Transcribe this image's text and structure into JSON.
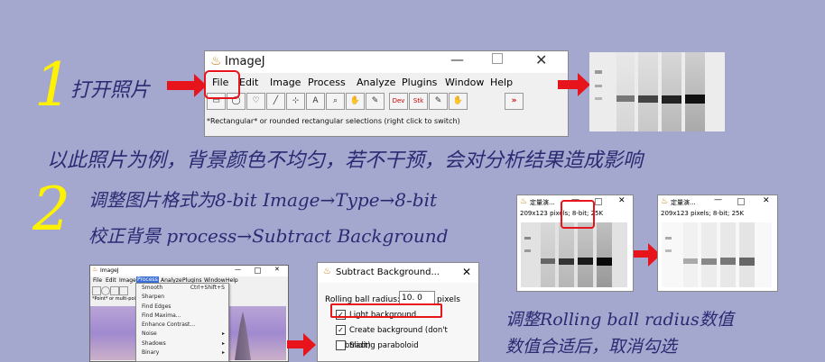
{
  "steps": {
    "step1_number": "1",
    "step1_text": "打开照片",
    "note_text": "以此照片为例，背景颜色不均匀，若不干预，会对分析结果造成影响",
    "step2_number": "2",
    "step2_line1": "调整图片格式为8-bit Image→Type→8-bit",
    "step2_line2": "校正背景 process→Subtract Background",
    "rolling_line1": "调整Rolling ball radius数值",
    "rolling_line2": "数值合适后，取消勾选"
  },
  "imagej": {
    "title": "ImageJ",
    "menu": [
      "File",
      "Edit",
      "Image",
      "Process",
      "Analyze",
      "Plugins",
      "Window",
      "Help"
    ],
    "tools": [
      "▭",
      "◯",
      "♡",
      "╱",
      "⊹",
      "A",
      "⌕",
      "✋",
      "✎",
      "Dev",
      "Stk",
      "✎",
      "✋",
      "»"
    ],
    "status": "*Rectangular* or rounded rectangular selections (right click to switch)"
  },
  "small_imagej": {
    "title": "ImageJ",
    "menu": [
      "File",
      "Edit",
      "Image",
      "Process",
      "Analyze",
      "Plugins",
      "Window",
      "Help"
    ],
    "status": "*Point* or multi-point s",
    "process_menu": [
      {
        "label": "Smooth",
        "shortcut": "Ctrl+Shift+S"
      },
      {
        "label": "Sharpen",
        "shortcut": ""
      },
      {
        "label": "Find Edges",
        "shortcut": ""
      },
      {
        "label": "Find Maxima...",
        "shortcut": ""
      },
      {
        "label": "Enhance Contrast...",
        "shortcut": ""
      },
      {
        "label": "Noise",
        "shortcut": "▸"
      },
      {
        "label": "Shadows",
        "shortcut": "▸"
      },
      {
        "label": "Binary",
        "shortcut": "▸"
      }
    ]
  },
  "gel_window_1": {
    "title": "定量演...",
    "info": "209x123 pixels; 8-bit; 25K"
  },
  "gel_window_2": {
    "title": "定量演...",
    "info": "209x123 pixels; 8-bit; 25K"
  },
  "subtract_dialog": {
    "title": "Subtract Background...",
    "radius_label": "Rolling ball radius:",
    "radius_value": "10. 0",
    "radius_unit": "pixels",
    "options": [
      {
        "label": "Light background",
        "checked": true
      },
      {
        "label": "Create background (don't subtract)",
        "checked": true
      },
      {
        "label": "Sliding paraboloid",
        "checked": false
      }
    ]
  },
  "colors": {
    "accent_red": "#e8141b",
    "bg": "#a4a8cf",
    "handwriting": "#2a2a72",
    "number": "#fff200"
  }
}
